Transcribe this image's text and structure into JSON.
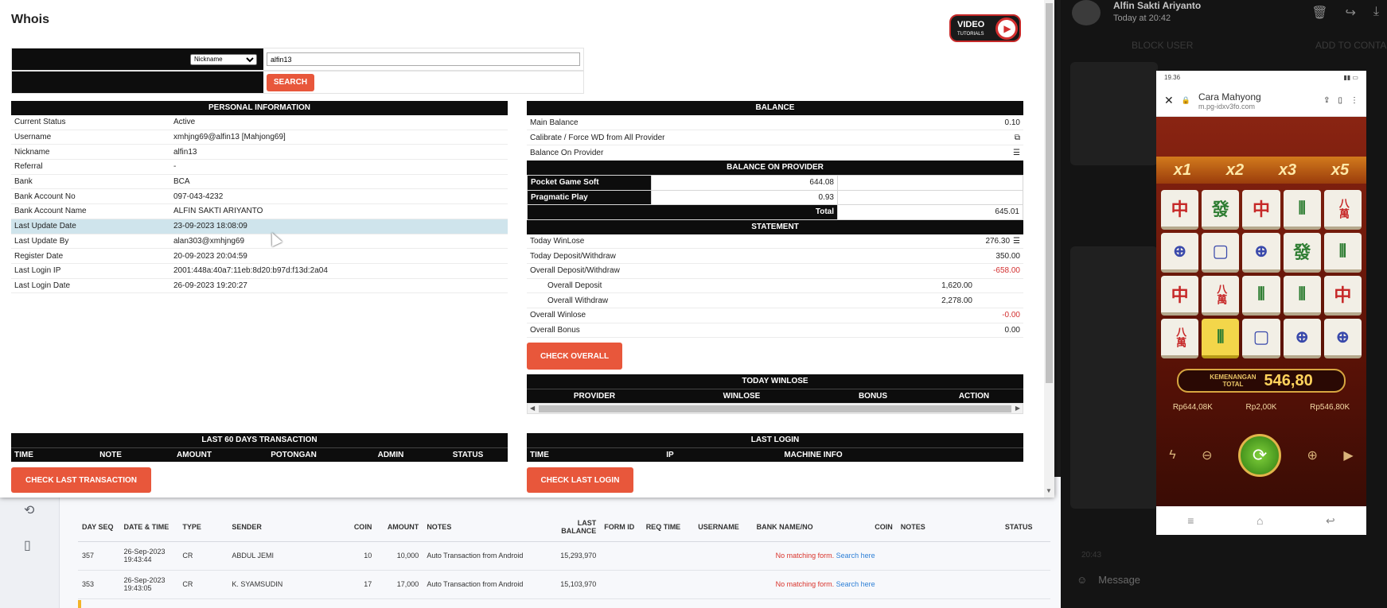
{
  "chat": {
    "sender_name": "Alfin Sakti Ariyanto",
    "time": "Today at 20:42",
    "ghost_block": "BLOCK USER",
    "ghost_add": "ADD TO CONTA",
    "message_placeholder": "Message",
    "ghost_time": "20:43"
  },
  "phone": {
    "status_time": "19.36",
    "page_title": "Cara Mahyong",
    "page_url": "m.pg-idxv3fo.com",
    "multipliers": [
      "x1",
      "x2",
      "x3",
      "x5"
    ],
    "tiles": [
      "中",
      "發",
      "中",
      "⦀",
      "八萬",
      "⊕",
      "▢",
      "⊕",
      "發",
      "⦀",
      "中",
      "八萬",
      "⦀",
      "⦀",
      "中",
      "八萬",
      "⦀",
      "▢",
      "⊕",
      "⊕"
    ],
    "win_label_1": "KEMENANGAN",
    "win_label_2": "TOTAL",
    "win_value": "546,80",
    "bal_1": "Rp644,08K",
    "bal_2": "Rp2,00K",
    "bal_3": "Rp546,80K"
  },
  "modal": {
    "title": "Whois",
    "video_line1": "VIDEO",
    "video_line2": "TUTORIALS",
    "search": {
      "select_value": "Nickname",
      "input_value": "alfin13",
      "button": "SEARCH"
    },
    "personal": {
      "heading": "PERSONAL INFORMATION",
      "rows": [
        {
          "k": "Current Status",
          "v": "Active"
        },
        {
          "k": "Username",
          "v": "xmhjng69@alfin13  [Mahjong69]"
        },
        {
          "k": "Nickname",
          "v": "alfin13"
        },
        {
          "k": "Referral",
          "v": "-"
        },
        {
          "k": "Bank",
          "v": "BCA"
        },
        {
          "k": "Bank Account No",
          "v": "097-043-4232"
        },
        {
          "k": "Bank Account Name",
          "v": "ALFIN SAKTI ARIYANTO"
        },
        {
          "k": "Last Update Date",
          "v": "23-09-2023 18:08:09"
        },
        {
          "k": "Last Update By",
          "v": "alan303@xmhjng69"
        },
        {
          "k": "Register Date",
          "v": "20-09-2023 20:04:59"
        },
        {
          "k": "Last Login IP",
          "v": "2001:448a:40a7:11eb:8d20:b97d:f13d:2a04"
        },
        {
          "k": "Last Login Date",
          "v": "26-09-2023 19:20:27"
        }
      ]
    },
    "balance": {
      "heading": "BALANCE",
      "main_balance_label": "Main Balance",
      "main_balance": "0.10",
      "calibrate_label": "Calibrate / Force WD from All Provider",
      "on_provider_label": "Balance On Provider"
    },
    "provider": {
      "heading": "BALANCE ON PROVIDER",
      "rows": [
        {
          "name": "Pocket Game Soft",
          "v": "644.08"
        },
        {
          "name": "Pragmatic Play",
          "v": "0.93"
        }
      ],
      "total_label": "Total",
      "total": "645.01"
    },
    "statement": {
      "heading": "STATEMENT",
      "today_winlose_label": "Today WinLose",
      "today_winlose": "276.30",
      "today_dw_label": "Today Deposit/Withdraw",
      "today_dw": "350.00",
      "overall_dw_label": "Overall Deposit/Withdraw",
      "overall_dw": "-658.00",
      "overall_dep_label": "Overall Deposit",
      "overall_dep": "1,620.00",
      "overall_wd_label": "Overall Withdraw",
      "overall_wd": "2,278.00",
      "overall_winlose_label": "Overall Winlose",
      "overall_winlose": "-0.00",
      "overall_bonus_label": "Overall Bonus",
      "overall_bonus": "0.00",
      "check_overall": "CHECK OVERALL"
    },
    "today_winlose": {
      "heading": "TODAY WINLOSE",
      "cols": [
        "PROVIDER",
        "WINLOSE",
        "BONUS",
        "ACTION"
      ]
    },
    "last60": {
      "heading": "LAST 60 DAYS TRANSACTION",
      "cols": [
        "TIME",
        "NOTE",
        "AMOUNT",
        "POTONGAN",
        "ADMIN",
        "STATUS"
      ],
      "button": "CHECK LAST TRANSACTION"
    },
    "last_login": {
      "heading": "LAST LOGIN",
      "cols": [
        "TIME",
        "IP",
        "MACHINE INFO"
      ],
      "button": "CHECK LAST LOGIN"
    }
  },
  "bgtable": {
    "headers": [
      "DAY SEQ",
      "DATE & TIME",
      "TYPE",
      "SENDER",
      "COIN",
      "AMOUNT",
      "NOTES",
      "LAST BALANCE",
      "FORM ID",
      "REQ TIME",
      "USERNAME",
      "BANK NAME/NO",
      "COIN",
      "NOTES",
      "STATUS"
    ],
    "rows": [
      {
        "seq": "357",
        "dt": "26-Sep-2023 19:43:44",
        "type": "CR",
        "sender": "ABDUL JEMI",
        "coin": "10",
        "amount": "10,000",
        "notes": "Auto Transaction from Android",
        "last": "15,293,970",
        "nomatch": "No matching form.",
        "search": "Search here"
      },
      {
        "seq": "353",
        "dt": "26-Sep-2023 19:43:05",
        "type": "CR",
        "sender": "K. SYAMSUDIN",
        "coin": "17",
        "amount": "17,000",
        "notes": "Auto Transaction from Android",
        "last": "15,103,970",
        "nomatch": "No matching form.",
        "search": "Search here"
      }
    ]
  }
}
